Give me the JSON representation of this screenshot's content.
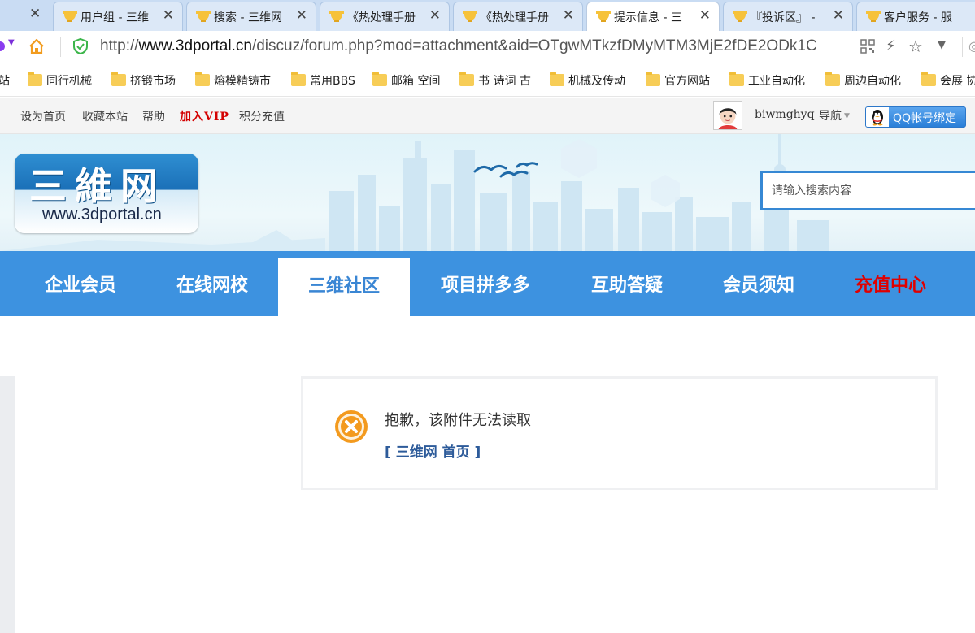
{
  "browser": {
    "tabs": [
      {
        "label": "用户组 - 三维",
        "active": false
      },
      {
        "label": "搜索 - 三维网",
        "active": false
      },
      {
        "label": "《热处理手册",
        "active": false
      },
      {
        "label": "《热处理手册",
        "active": false
      },
      {
        "label": "提示信息 - 三",
        "active": true
      },
      {
        "label": "『投诉区』 - ",
        "active": false
      },
      {
        "label": "客户服务 - 服",
        "active": false
      }
    ],
    "close_glyph": "✕",
    "url_prefix": "http://",
    "url_host": "www.3dportal.cn",
    "url_path": "/discuz/forum.php?mod=attachment&aid=OTgwMTkzfDMyMTM3MjE2fDE2ODk1C"
  },
  "bookmarks": [
    {
      "label": "站",
      "folder": false
    },
    {
      "label": "同行机械",
      "folder": true
    },
    {
      "label": "挤锻市场",
      "folder": true
    },
    {
      "label": "熔模精铸市",
      "folder": true
    },
    {
      "label": "常用BBS",
      "folder": true
    },
    {
      "label": "邮箱 空间",
      "folder": true
    },
    {
      "label": "书 诗词 古",
      "folder": true
    },
    {
      "label": "机械及传动",
      "folder": true
    },
    {
      "label": "官方网站",
      "folder": true
    },
    {
      "label": "工业自动化",
      "folder": true
    },
    {
      "label": "周边自动化",
      "folder": true
    },
    {
      "label": "会展 协",
      "folder": true
    }
  ],
  "sitebar": {
    "set_home": "设为首页",
    "bookmark_site": "收藏本站",
    "help": "帮助",
    "join_vip": "加入VIP",
    "recharge_points": "积分充值",
    "username": "biwmghyq",
    "nav": "导航",
    "qq_bind": "QQ帐号绑定"
  },
  "banner": {
    "logo_title": "三維网",
    "logo_url": "www.3dportal.cn",
    "search_placeholder": "请输入搜索内容"
  },
  "mainnav": [
    {
      "label": "企业会员",
      "active": false,
      "hot": false
    },
    {
      "label": "在线网校",
      "active": false,
      "hot": false
    },
    {
      "label": "三维社区",
      "active": true,
      "hot": false
    },
    {
      "label": "项目拼多多",
      "active": false,
      "hot": false
    },
    {
      "label": "互助答疑",
      "active": false,
      "hot": false
    },
    {
      "label": "会员须知",
      "active": false,
      "hot": false
    },
    {
      "label": "充值中心",
      "active": false,
      "hot": true
    }
  ],
  "message": {
    "text": "抱歉，该附件无法读取",
    "home_link": "[ 三维网 首页 ]"
  },
  "colors": {
    "nav_blue": "#3d92e0",
    "hot_red": "#e00000",
    "link_blue": "#2d5b9a",
    "error_orange": "#f39a1e"
  },
  "icons": {
    "tab_favicon": "trophy-cup-icon",
    "home": "home-icon",
    "secure": "shield-check-icon",
    "qr": "qr-code-icon",
    "bolt": "lightning-icon",
    "favorite": "star-icon",
    "error": "error-x-icon"
  }
}
